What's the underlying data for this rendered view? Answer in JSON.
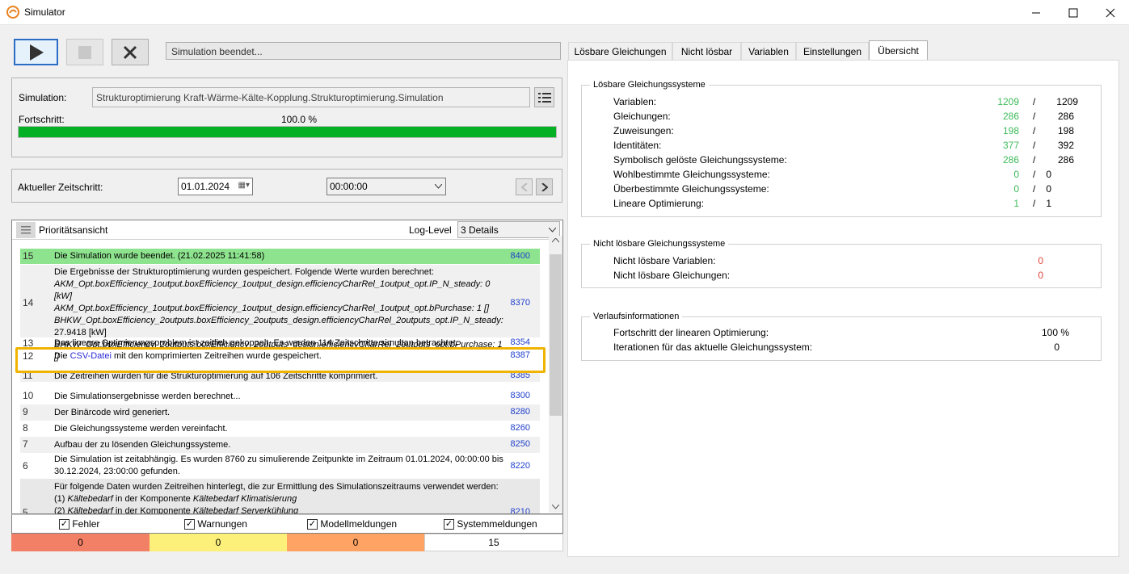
{
  "window": {
    "title": "Simulator"
  },
  "toolbar": {
    "status_text": "Simulation beendet..."
  },
  "simulation": {
    "label": "Simulation:",
    "value": "Strukturoptimierung Kraft-Wärme-Kälte-Kopplung.Strukturoptimierung.Simulation",
    "progress_label": "Fortschritt:",
    "progress_text": "100.0 %",
    "progress_fraction": 1.0
  },
  "timestep": {
    "label": "Aktueller Zeitschritt:",
    "date": "01.01.2024",
    "time": "00:00:00"
  },
  "log": {
    "priority_label": "Prioritätsansicht",
    "loglevel_label": "Log-Level",
    "loglevel_value": "3 Details",
    "rows": [
      {
        "num": "15",
        "msg": "Die Simulation wurde beendet. (21.02.2025 11:41:58)",
        "code": "8400"
      },
      {
        "num": "14",
        "lines": [
          "Die Ergebnisse der Strukturoptimierung wurden gespeichert. Folgende Werte wurden berechnet:",
          "AKM_Opt.boxEfficiency_1output.boxEfficiency_1output_design.efficiencyCharRel_1output_opt.IP_N_steady: 0 [kW]",
          "AKM_Opt.boxEfficiency_1output.boxEfficiency_1output_design.efficiencyCharRel_1output_opt.bPurchase: 1 []",
          "BHKW_Opt.boxEfficiency_2outputs.boxEfficiency_2outputs_design.efficiencyCharRel_2outputs_opt.IP_N_steady:",
          "27.9418 [kW]",
          "BHKW_Opt.boxEfficiency_2outputs.boxEfficiency_2outputs_design.efficiencyCharRel_2outputs_opt.bPurchase: 1 []"
        ],
        "code": "8370"
      },
      {
        "num": "13",
        "msg": "Das lineare Optimierungsproblem ist zeitlich gekoppelt. Es werden 114 Zeitschritte simultan betrachtet.",
        "code": "8354"
      },
      {
        "num": "12",
        "msg_pre": "Die ",
        "msg_link": "CSV-Datei",
        "msg_post": " mit den komprimierten Zeitreihen wurde gespeichert.",
        "code": "8387"
      },
      {
        "num": "11",
        "msg": "Die Zeitreihen wurden für die Strukturoptimierung auf 106 Zeitschritte komprimiert.",
        "code": "8385"
      },
      {
        "num": "10",
        "msg": "Die Simulationsergebnisse werden berechnet...",
        "code": "8300"
      },
      {
        "num": "9",
        "msg": "Der Binärcode wird generiert.",
        "code": "8280"
      },
      {
        "num": "8",
        "msg": "Die Gleichungssysteme werden vereinfacht.",
        "code": "8260"
      },
      {
        "num": "7",
        "msg": "Aufbau der zu lösenden Gleichungssysteme.",
        "code": "8250"
      },
      {
        "num": "6",
        "line1": "Die Simulation ist zeitabhängig. Es wurden 8760 zu simulierende Zeitpunkte im Zeitraum 01.01.2024, 00:00:00 bis",
        "line2": "30.12.2024, 23:00:00 gefunden.",
        "code": "8220"
      },
      {
        "num": "5",
        "line1": "Für folgende Daten wurden Zeitreihen hinterlegt, die zur Ermittlung des Simulationszeitraums verwendet werden:",
        "line2_pre": "(1) ",
        "line2_it": "Kältebedarf",
        "line2_mid": " in der Komponente ",
        "line2_it2": "Kältebedarf Klimatisierung",
        "line3_pre": "(2) ",
        "line3_it": "Kältebedarf",
        "line3_mid": " in der Komponente ",
        "line3_it2": "Kältebedarf Serverkühlung",
        "code": "8210"
      }
    ]
  },
  "filters": {
    "fehler": "Fehler",
    "warnungen": "Warnungen",
    "modell": "Modellmeldungen",
    "system": "Systemmeldungen",
    "counts": [
      "0",
      "0",
      "0",
      "15"
    ]
  },
  "colors": {
    "error": "#f28066",
    "warning": "#fdf07a",
    "model": "#fea363",
    "progress": "#06b025",
    "highlight": "#f0b400"
  },
  "tabs": [
    "Lösbare Gleichungen",
    "Nicht lösbar",
    "Variablen",
    "Einstellungen",
    "Übersicht"
  ],
  "overview": {
    "solvable": {
      "title": "Lösbare Gleichungssysteme",
      "rows": [
        {
          "label": "Variablen:",
          "a": "1209",
          "b": "1209"
        },
        {
          "label": "Gleichungen:",
          "a": "286",
          "b": "286"
        },
        {
          "label": "Zuweisungen:",
          "a": "198",
          "b": "198"
        },
        {
          "label": "Identitäten:",
          "a": "377",
          "b": "392"
        },
        {
          "label": "Symbolisch gelöste Gleichungssysteme:",
          "a": "286",
          "b": "286"
        },
        {
          "label": "Wohlbestimmte Gleichungssysteme:",
          "a": "0",
          "b": "0"
        },
        {
          "label": "Überbestimmte Gleichungssysteme:",
          "a": "0",
          "b": "0"
        },
        {
          "label": "Lineare Optimierung:",
          "a": "1",
          "b": "1"
        }
      ]
    },
    "unsolvable": {
      "title": "Nicht lösbare Gleichungssysteme",
      "rows": [
        {
          "label": "Nicht lösbare Variablen:",
          "a": "0"
        },
        {
          "label": "Nicht lösbare Gleichungen:",
          "a": "0"
        }
      ]
    },
    "history": {
      "title": "Verlaufsinformationen",
      "rows": [
        {
          "label": "Fortschritt der linearen Optimierung:",
          "a": "100 %"
        },
        {
          "label": "Iterationen für das aktuelle Gleichungssystem:",
          "a": "0"
        }
      ]
    }
  }
}
